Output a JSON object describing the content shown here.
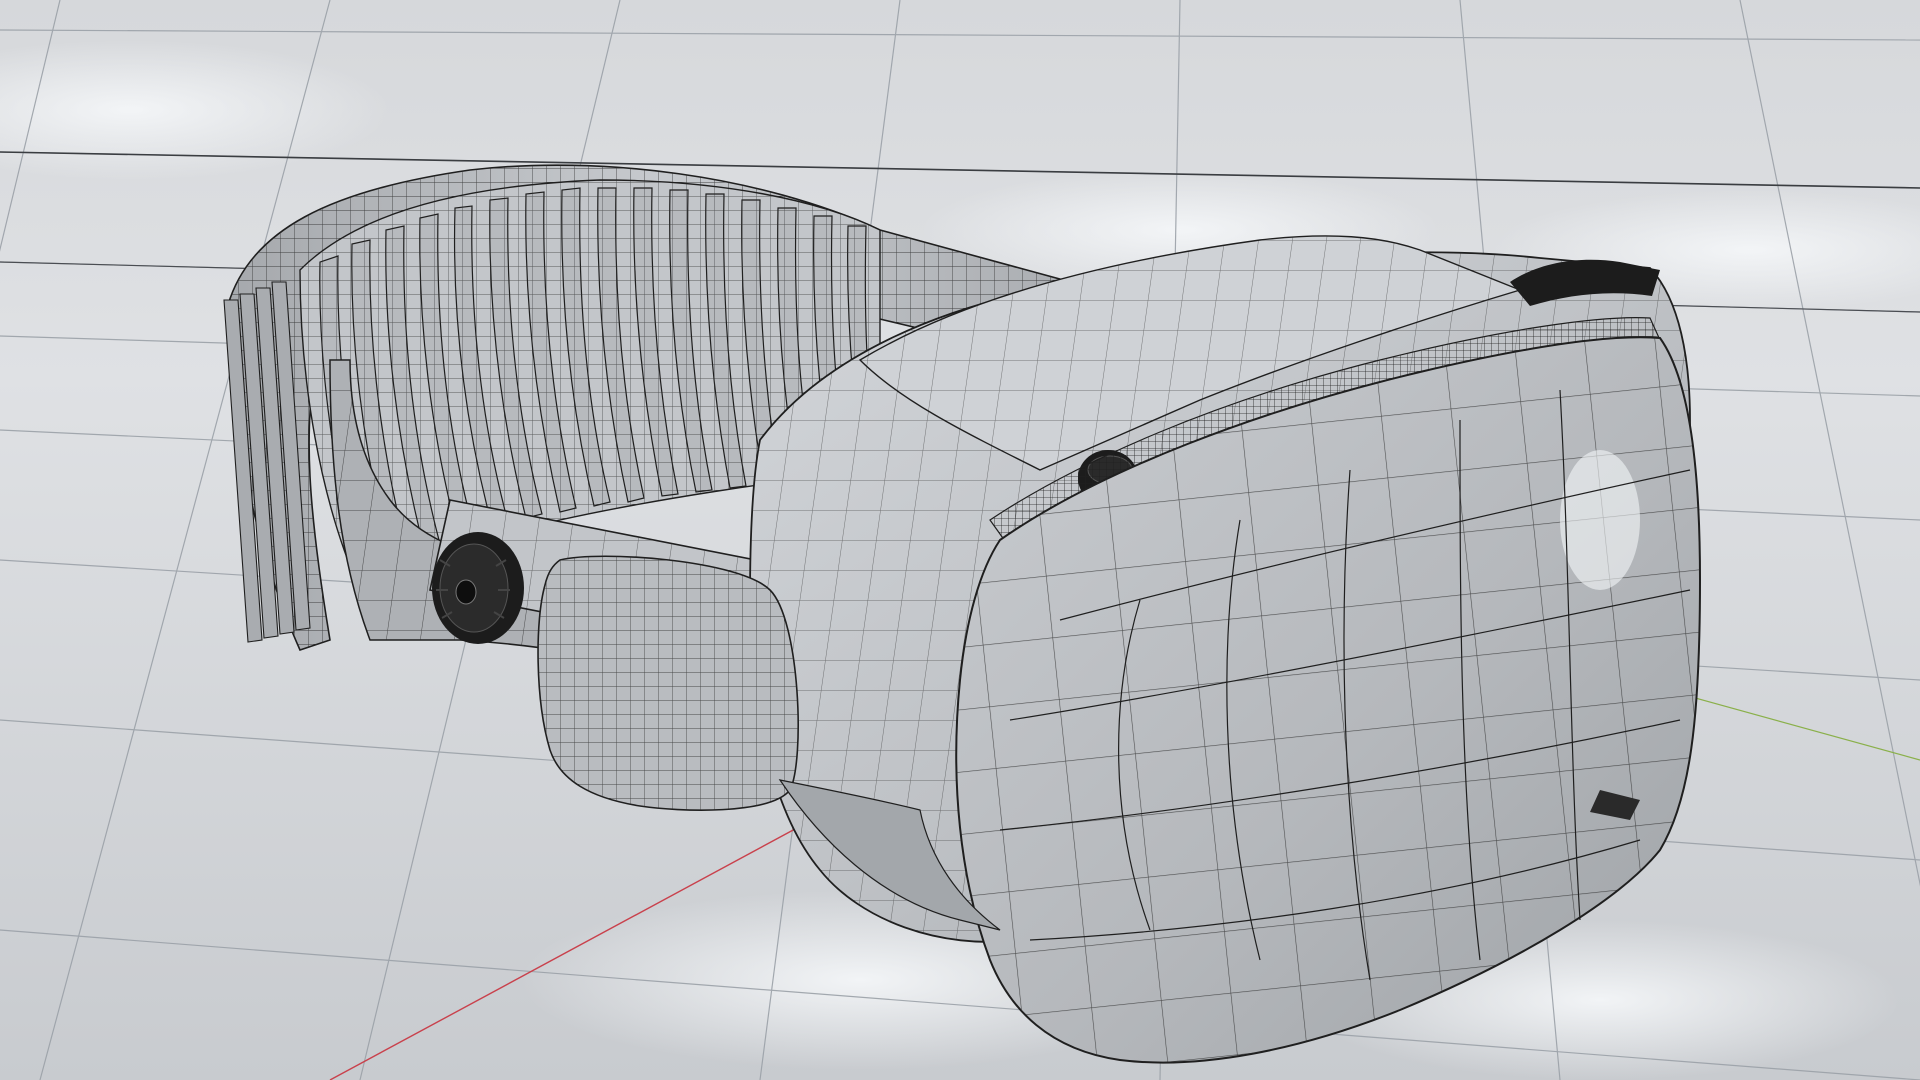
{
  "scene": {
    "subject": "headset-wireframe-model",
    "shading": "solid-with-wireframe-overlay",
    "background_color": "#cfd2d6",
    "sky_highlight_color": "#eef1f4",
    "floor_grid_color": "#9da3aa",
    "model_color": "#b9bcc0",
    "wire_color": "#2a2a2a",
    "axis_x_color": "#c9414c",
    "axis_y_color": "#8ab04a",
    "control_color": "#1c1c1c"
  }
}
